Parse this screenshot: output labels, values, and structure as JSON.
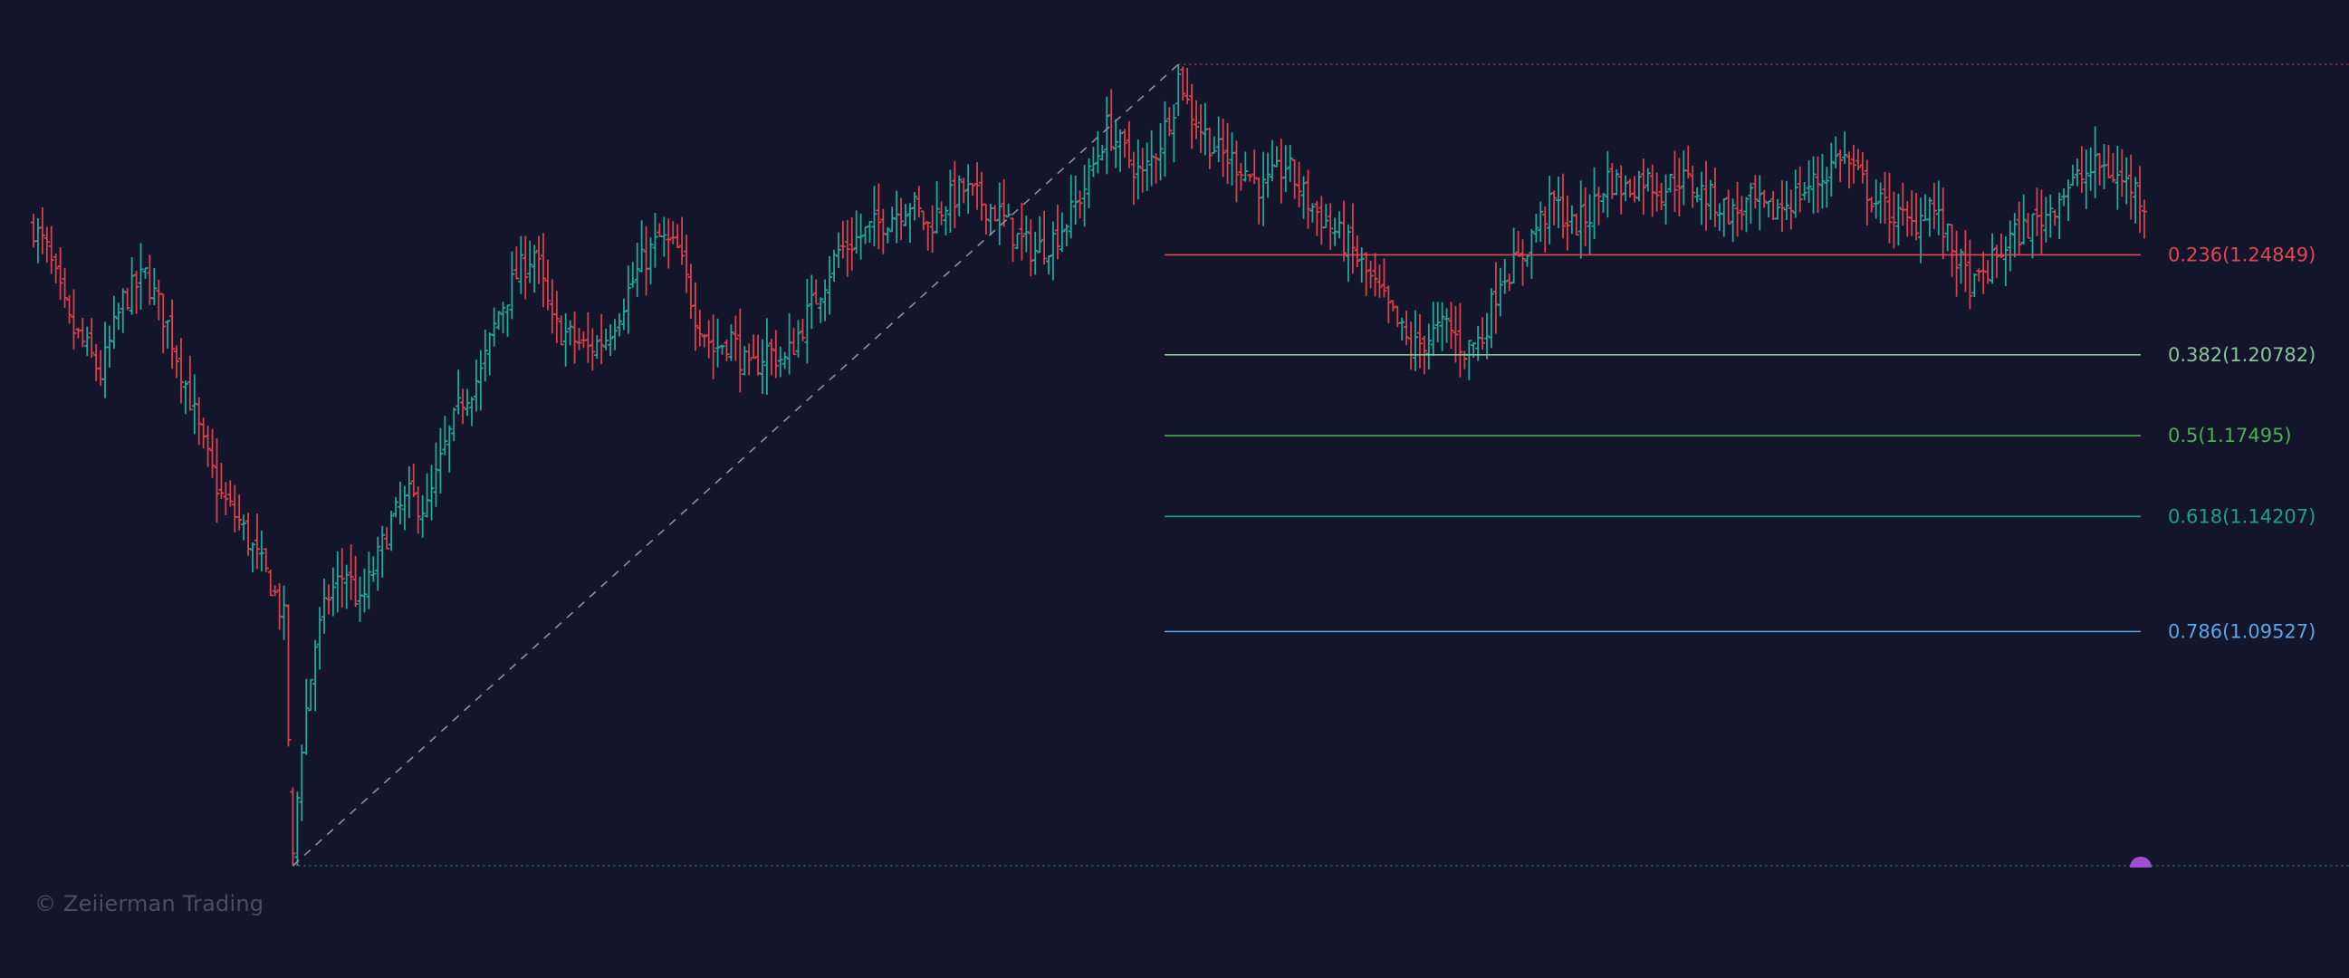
{
  "watermark": "© Zeiierman Trading",
  "colors": {
    "background": "#13152b",
    "bull": "#22a79b",
    "bear": "#d9414b",
    "high_line": "#c24652",
    "low_line": "#2e8b63",
    "trend_line": "#8d8f9e",
    "marker": "#a14fd1"
  },
  "chart_data": {
    "type": "ohlc",
    "title": "",
    "xlabel": "",
    "ylabel": "",
    "grid": false,
    "swing_low": 1.0,
    "swing_high": 1.326,
    "fib_levels": [
      {
        "label": "0.236(1.24849)",
        "ratio": 0.236,
        "price": 1.24849,
        "color": "#e0474f"
      },
      {
        "label": "0.382(1.20782)",
        "ratio": 0.382,
        "price": 1.20782,
        "color": "#89c497"
      },
      {
        "label": "0.5(1.17495)",
        "ratio": 0.5,
        "price": 1.17495,
        "color": "#4caf50"
      },
      {
        "label": "0.618(1.14207)",
        "ratio": 0.618,
        "price": 1.14207,
        "color": "#1f9e93"
      },
      {
        "label": "0.786(1.09527)",
        "ratio": 0.786,
        "price": 1.09527,
        "color": "#5aa6e8"
      }
    ],
    "price_path": [
      [
        0,
        1.26
      ],
      [
        3,
        1.25
      ],
      [
        8,
        1.22
      ],
      [
        12,
        1.21
      ],
      [
        15,
        1.2
      ],
      [
        20,
        1.23
      ],
      [
        25,
        1.24
      ],
      [
        30,
        1.22
      ],
      [
        35,
        1.19
      ],
      [
        38,
        1.17
      ],
      [
        42,
        1.15
      ],
      [
        46,
        1.14
      ],
      [
        50,
        1.125
      ],
      [
        53,
        1.115
      ],
      [
        56,
        1.1
      ],
      [
        58,
        1.005
      ],
      [
        60,
        1.05
      ],
      [
        63,
        1.09
      ],
      [
        66,
        1.11
      ],
      [
        70,
        1.12
      ],
      [
        73,
        1.105
      ],
      [
        76,
        1.12
      ],
      [
        80,
        1.14
      ],
      [
        84,
        1.15
      ],
      [
        88,
        1.145
      ],
      [
        92,
        1.17
      ],
      [
        96,
        1.19
      ],
      [
        100,
        1.2
      ],
      [
        104,
        1.225
      ],
      [
        108,
        1.24
      ],
      [
        112,
        1.25
      ],
      [
        116,
        1.22
      ],
      [
        120,
        1.215
      ],
      [
        124,
        1.21
      ],
      [
        128,
        1.215
      ],
      [
        132,
        1.23
      ],
      [
        136,
        1.245
      ],
      [
        140,
        1.255
      ],
      [
        144,
        1.25
      ],
      [
        148,
        1.225
      ],
      [
        152,
        1.21
      ],
      [
        156,
        1.215
      ],
      [
        160,
        1.2
      ],
      [
        164,
        1.21
      ],
      [
        168,
        1.205
      ],
      [
        172,
        1.22
      ],
      [
        176,
        1.235
      ],
      [
        180,
        1.25
      ],
      [
        184,
        1.255
      ],
      [
        188,
        1.26
      ],
      [
        192,
        1.265
      ],
      [
        196,
        1.27
      ],
      [
        200,
        1.26
      ],
      [
        204,
        1.27
      ],
      [
        208,
        1.275
      ],
      [
        212,
        1.27
      ],
      [
        216,
        1.265
      ],
      [
        220,
        1.255
      ],
      [
        224,
        1.25
      ],
      [
        228,
        1.255
      ],
      [
        232,
        1.265
      ],
      [
        236,
        1.28
      ],
      [
        240,
        1.3
      ],
      [
        244,
        1.29
      ],
      [
        248,
        1.28
      ],
      [
        252,
        1.295
      ],
      [
        255,
        1.31
      ],
      [
        256,
        1.325
      ],
      [
        258,
        1.31
      ],
      [
        261,
        1.3
      ],
      [
        265,
        1.29
      ],
      [
        270,
        1.285
      ],
      [
        275,
        1.275
      ],
      [
        280,
        1.285
      ],
      [
        285,
        1.27
      ],
      [
        290,
        1.26
      ],
      [
        295,
        1.25
      ],
      [
        300,
        1.235
      ],
      [
        305,
        1.22
      ],
      [
        308,
        1.21
      ],
      [
        312,
        1.215
      ],
      [
        316,
        1.22
      ],
      [
        320,
        1.21
      ],
      [
        324,
        1.215
      ],
      [
        328,
        1.24
      ],
      [
        332,
        1.245
      ],
      [
        336,
        1.26
      ],
      [
        340,
        1.27
      ],
      [
        344,
        1.26
      ],
      [
        348,
        1.265
      ],
      [
        352,
        1.28
      ],
      [
        356,
        1.275
      ],
      [
        360,
        1.28
      ],
      [
        364,
        1.275
      ],
      [
        368,
        1.28
      ],
      [
        372,
        1.275
      ],
      [
        376,
        1.27
      ],
      [
        380,
        1.265
      ],
      [
        384,
        1.27
      ],
      [
        388,
        1.265
      ],
      [
        392,
        1.27
      ],
      [
        396,
        1.275
      ],
      [
        400,
        1.28
      ],
      [
        404,
        1.29
      ],
      [
        408,
        1.28
      ],
      [
        412,
        1.27
      ],
      [
        416,
        1.265
      ],
      [
        420,
        1.26
      ],
      [
        424,
        1.27
      ],
      [
        428,
        1.255
      ],
      [
        432,
        1.24
      ],
      [
        434,
        1.235
      ],
      [
        438,
        1.245
      ],
      [
        442,
        1.255
      ],
      [
        446,
        1.26
      ],
      [
        450,
        1.265
      ],
      [
        454,
        1.275
      ],
      [
        458,
        1.28
      ],
      [
        462,
        1.285
      ],
      [
        466,
        1.28
      ],
      [
        470,
        1.275
      ],
      [
        472,
        1.27
      ]
    ]
  }
}
